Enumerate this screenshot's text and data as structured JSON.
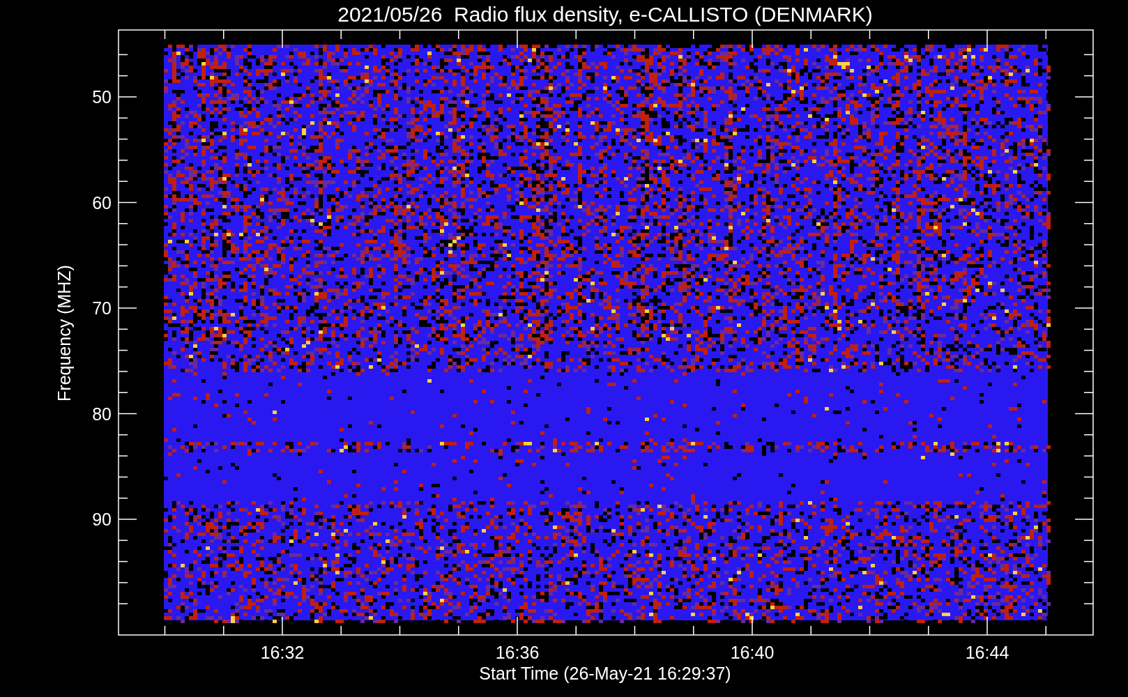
{
  "plot": {
    "title": "2021/05/26  Radio flux density, e-CALLISTO (DENMARK)",
    "ylabel": "Frequency (MHZ)",
    "xlabel": "Start Time (26-May-21 16:29:37)",
    "yticks": [
      "50",
      "60",
      "70",
      "80",
      "90"
    ],
    "xticks": [
      "16:32",
      "16:36",
      "16:40",
      "16:44"
    ]
  }
}
